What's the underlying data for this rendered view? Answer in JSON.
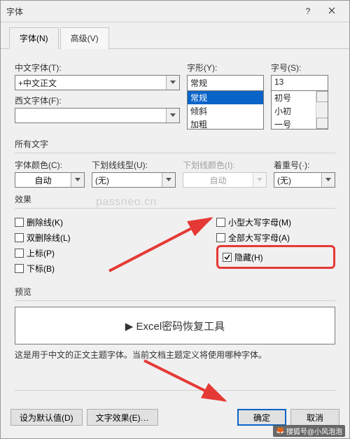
{
  "titlebar": {
    "title": "字体"
  },
  "tabs": {
    "font": "字体(N)",
    "advanced": "高级(V)"
  },
  "labels": {
    "cn_font": "中文字体(T):",
    "western_font": "西文字体(F):",
    "style": "字形(Y):",
    "size": "字号(S):",
    "all_text": "所有文字",
    "font_color": "字体颜色(C):",
    "underline_style": "下划线线型(U):",
    "underline_color": "下划线颜色(I):",
    "emphasis": "着重号(·):",
    "effects": "效果",
    "preview": "预览"
  },
  "fields": {
    "cn_font": "+中文正文",
    "western_font": "",
    "style_value": "常规",
    "style_options": [
      "常规",
      "倾斜",
      "加粗"
    ],
    "size_value": "13",
    "size_options": [
      "初号",
      "小初",
      "一号"
    ],
    "font_color_auto": "自动",
    "underline_style": "(无)",
    "underline_color": "自动",
    "emphasis": "(无)"
  },
  "effects": {
    "strike": "删除线(K)",
    "dblstrike": "双删除线(L)",
    "superscript": "上标(P)",
    "subscript": "下标(B)",
    "smallcaps": "小型大写字母(M)",
    "allcaps": "全部大写字母(A)",
    "hidden": "隐藏(H)"
  },
  "preview_text": "▶  Excel密码恢复工具",
  "desc": "这是用于中文的正文主题字体。当前文档主题定义将使用哪种字体。",
  "buttons": {
    "set_default": "设为默认值(D)",
    "text_effects": "文字效果(E)…",
    "ok": "确定",
    "cancel": "取消"
  },
  "watermark": "passneo.cn",
  "sohu": "搜狐号@小风泡泡"
}
